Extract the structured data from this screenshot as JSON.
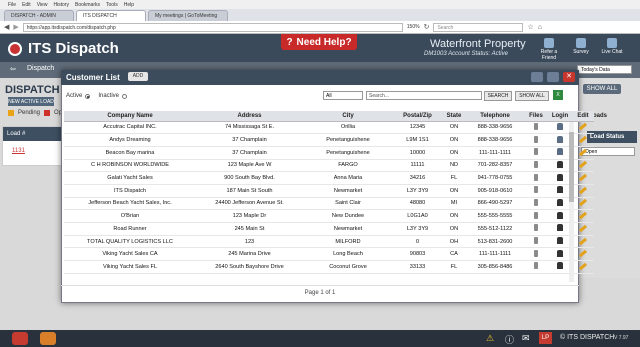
{
  "browser": {
    "menu": [
      "File",
      "Edit",
      "View",
      "History",
      "Bookmarks",
      "Tools",
      "Help"
    ],
    "tabs": [
      "DISPATCH - ADMIN",
      "ITS DISPATCH",
      "My meetings | GoToMeeting"
    ],
    "url": "https://app.itsdispatch.com/dispatch.php",
    "zoom": "150%",
    "search_placeholder": "Search"
  },
  "app": {
    "name": "ITS Dispatch",
    "help": "Need Help?",
    "company": "Waterfront Property",
    "account_id": "DM1003",
    "account_status": "Account Status: Active",
    "header_icons": [
      "Refer a Friend",
      "Survey",
      "Live Chat"
    ],
    "nav_tab": "Dispatch",
    "page_title": "DISPATCH",
    "new_active_load": "NEW ACTIVE LOAD",
    "legend": [
      {
        "label": "Pending",
        "color": "#e8a317"
      },
      {
        "label": "Op",
        "color": "#d0302a"
      }
    ],
    "bg_header": "Load #",
    "bg_link": "1131",
    "right_dropdown": "Today's Data",
    "right_show_all": "SHOW ALL",
    "right_label_a": "pleted Loads",
    "right_label_b": "Load Status",
    "right_select": "Open"
  },
  "modal": {
    "title": "Customer List",
    "add": "ADD",
    "filter_active": "Active",
    "filter_inactive": "Inactive",
    "select_value": "All",
    "search_placeholder": "Search...",
    "search_button": "SEARCH",
    "show_all_button": "SHOW ALL",
    "columns": [
      "Company Name",
      "Address",
      "City",
      "Postal/Zip",
      "State",
      "Telephone",
      "Files",
      "Login",
      "Edit"
    ],
    "rows": [
      [
        "Accutrac Capital INC.",
        "74 Mississaga St E.",
        "Orillia",
        "12345",
        "ON",
        "888-338-9656"
      ],
      [
        "Andys Dreaming",
        "37 Champlain",
        "Penetanguishene",
        "L9M 1S1",
        "ON",
        "888-338-9656"
      ],
      [
        "Beacon Bay marina",
        "37 Champlain",
        "Penetanguishene",
        "10000",
        "ON",
        "111-111-1111"
      ],
      [
        "C H ROBINSON WORLDWIDE",
        "123 Maple Ave W",
        "FARGO",
        "11111",
        "ND",
        "701-282-8357"
      ],
      [
        "Galati Yacht Sales",
        "900 South Bay Blvd.",
        "Anna Maria",
        "34216",
        "FL",
        "941-778-0755"
      ],
      [
        "ITS Dispatch",
        "187 Main St South",
        "Newmarket",
        "L3Y 3Y9",
        "ON",
        "905-918-0610"
      ],
      [
        "Jefferson Beach Yacht Sales, Inc.",
        "24400 Jefferson Avenue St.",
        "Saint Clair",
        "48080",
        "MI",
        "866-490-5297"
      ],
      [
        "O'Brian",
        "123 Maple Dr",
        "New Dundee",
        "L0G1A0",
        "ON",
        "555-555-5555"
      ],
      [
        "Road Runner",
        "245 Main St",
        "Newmarket",
        "L3Y 3Y9",
        "ON",
        "555-512-1122"
      ],
      [
        "TOTAL QUALITY LOGISTICS LLC",
        "123",
        "MILFORD",
        "0",
        "OH",
        "513-831-2600"
      ],
      [
        "Viking Yacht Sales CA",
        "245 Marina Drive",
        "Long Beach",
        "90803",
        "CA",
        "111-111-1111"
      ],
      [
        "Viking Yacht Sales FL",
        "2640 South Bayshore Drive",
        "Coconut Grove",
        "33133",
        "FL",
        "305-856-8486"
      ]
    ],
    "pager": "Page 1 of 1"
  },
  "taskbar": {
    "brand": "ITS DISPATCH",
    "version": "V 7.97"
  }
}
